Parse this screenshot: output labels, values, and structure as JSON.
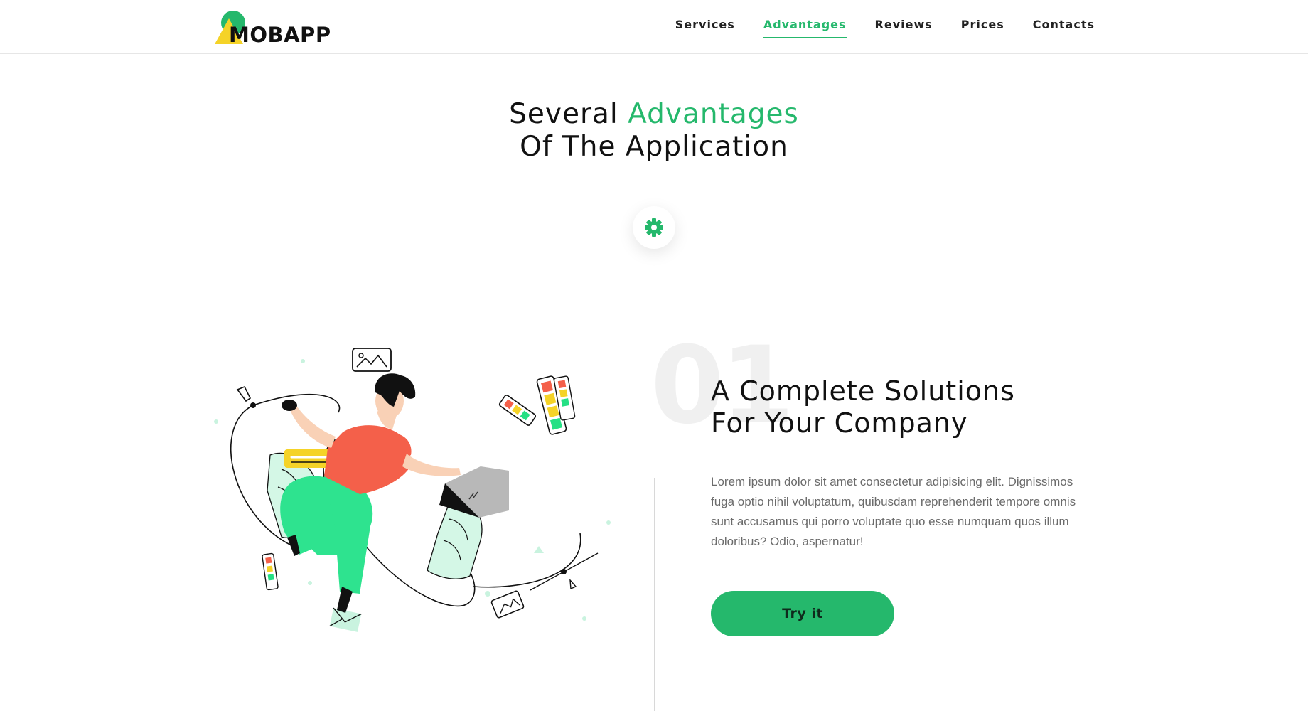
{
  "header": {
    "logo_text": "MOBAPP",
    "nav": [
      {
        "label": "Services"
      },
      {
        "label": "Advantages",
        "active": true
      },
      {
        "label": "Reviews"
      },
      {
        "label": "Prices"
      },
      {
        "label": "Contacts"
      }
    ]
  },
  "section": {
    "title_part1": "Several ",
    "title_accent": "Advantages",
    "title_line2": "Of The Application",
    "badge_icon": "gear-icon"
  },
  "feature": {
    "number": "01",
    "title_line1": "A Complete Solutions",
    "title_line2": "For Your Company",
    "description": "Lorem ipsum dolor sit amet consectetur adipisicing elit. Dignissimos fuga optio nihil voluptatum, quibusdam reprehenderit tempore omnis sunt accusamus qui porro voluptate quo esse numquam quos illum doloribus? Odio, aspernatur!",
    "cta_label": "Try it",
    "illustration": "person-working-with-laptop-illustration"
  },
  "colors": {
    "accent": "#25b86c",
    "logo_yellow": "#f5d327",
    "illustration_red": "#f4604a",
    "illustration_mint": "#d4f7e6"
  }
}
